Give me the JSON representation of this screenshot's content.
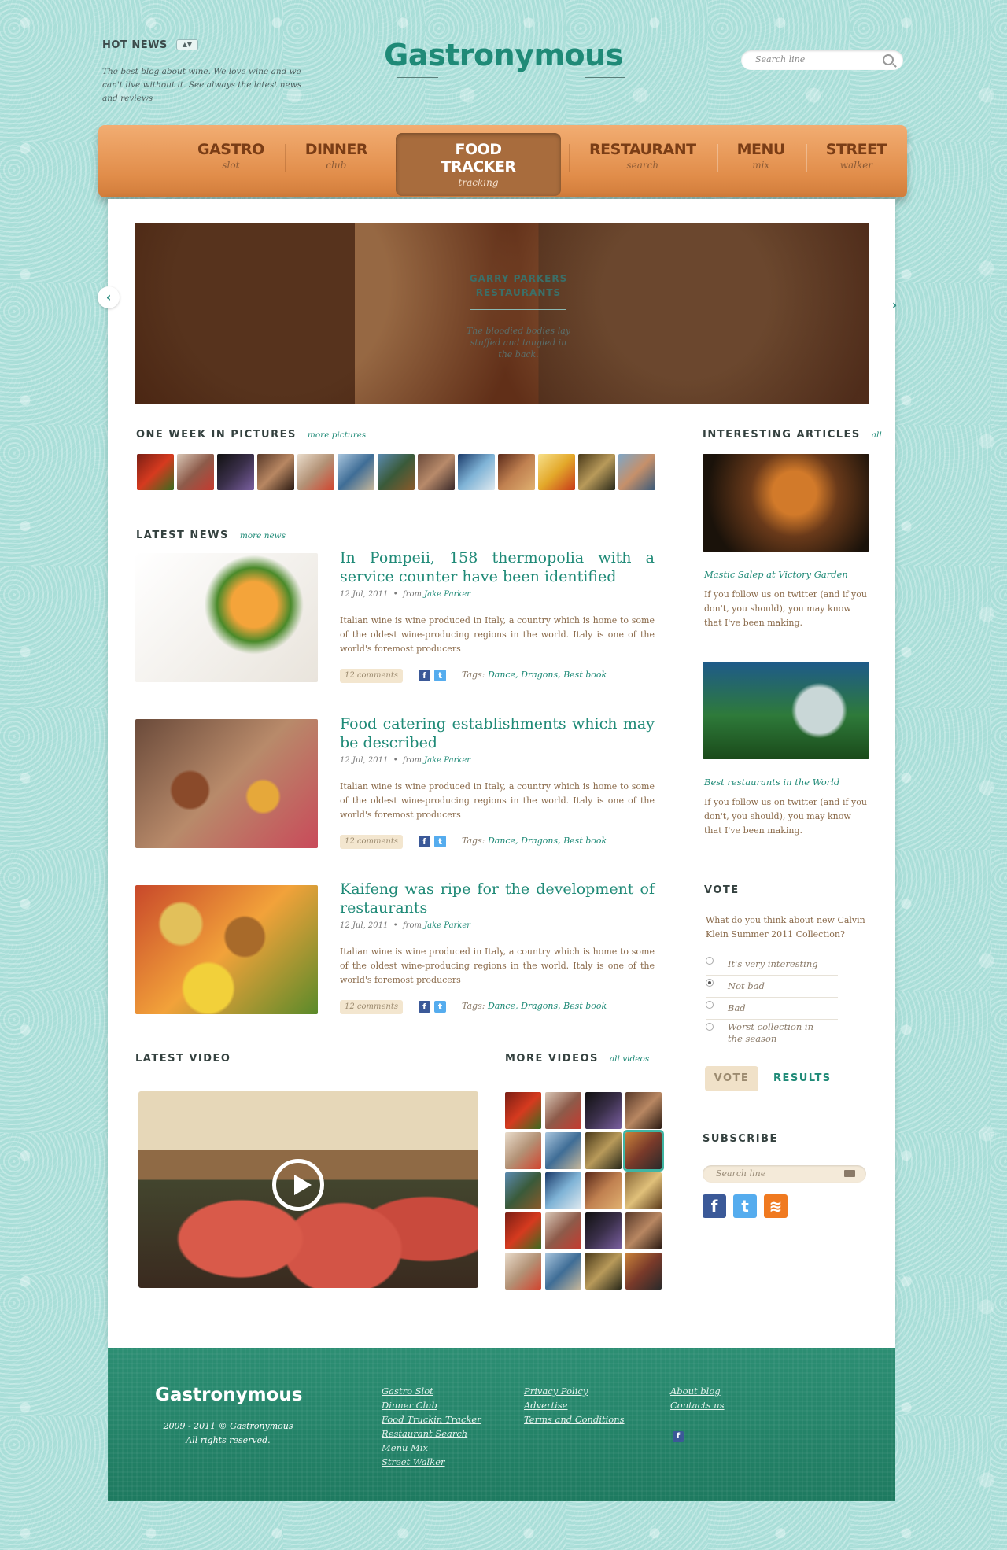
{
  "header": {
    "hot_news_title": "HOT NEWS",
    "hot_news_desc": "The best blog about wine. We love wine and we can't live without it. See always the latest news and reviews",
    "logo": "Gastronymous",
    "search_placeholder": "Search line"
  },
  "nav": [
    {
      "label": "GASTRO",
      "sub": "slot"
    },
    {
      "label": "DINNER",
      "sub": "club"
    },
    {
      "label": "FOOD TRACKER",
      "sub": "tracking",
      "active": true
    },
    {
      "label": "RESTAURANT",
      "sub": "search"
    },
    {
      "label": "MENU",
      "sub": "mix"
    },
    {
      "label": "STREET",
      "sub": "walker"
    }
  ],
  "slider": {
    "title_line1": "GARRY PARKERS",
    "title_line2": "RESTAURANTS",
    "desc": "The bloodied bodies lay stuffed and tangled in the back."
  },
  "pictures": {
    "title": "ONE WEEK IN PICTURES",
    "more": "more pictures"
  },
  "latest_news": {
    "title": "LATEST NEWS",
    "more": "more news",
    "items": [
      {
        "title": "In Pompeii, 158 thermopolia with a service counter have been identified",
        "date": "12 Jul, 2011",
        "from": "from",
        "author": "Jake Parker",
        "body": "Italian wine is wine produced in Italy, a country which is home to some of the oldest wine-producing regions in the world. Italy is one of the world's foremost producers",
        "comments": "12 comments",
        "tags_label": "Tags:",
        "tags": "Dance, Dragons, Best book"
      },
      {
        "title": "Food catering establishments which may be described",
        "date": "12 Jul, 2011",
        "from": "from",
        "author": "Jake Parker",
        "body": "Italian wine is wine produced in Italy, a country which is home to some of the oldest wine-producing regions in the world. Italy is one of the world's foremost producers",
        "comments": "12 comments",
        "tags_label": "Tags:",
        "tags": "Dance, Dragons, Best book"
      },
      {
        "title": "Kaifeng was ripe for the development of restaurants",
        "date": "12 Jul, 2011",
        "from": "from",
        "author": "Jake Parker",
        "body": "Italian wine is wine produced in Italy, a country which is home to some of the oldest wine-producing regions in the world. Italy is one of the world's foremost producers",
        "comments": "12 comments",
        "tags_label": "Tags:",
        "tags": "Dance, Dragons, Best book"
      }
    ]
  },
  "articles": {
    "title": "INTERESTING ARTICLES",
    "more": "all",
    "items": [
      {
        "title": "Mastic Salep at Victory Garden",
        "body": "If you follow us on twitter (and if you don't, you should), you may know that I've been making."
      },
      {
        "title": "Best restaurants in the World",
        "body": "If you follow us on twitter (and if you don't, you should), you may know that I've been making."
      }
    ]
  },
  "vote": {
    "title": "VOTE",
    "question": "What do you think about new Calvin Klein Summer 2011 Collection?",
    "options": [
      "It's very interesting",
      "Not bad",
      "Bad",
      "Worst collection in the season"
    ],
    "selected": 1,
    "vote_button": "VOTE",
    "results_button": "RESULTS"
  },
  "subscribe": {
    "title": "SUBSCRIBE",
    "placeholder": "Search line"
  },
  "video": {
    "latest_title": "LATEST VIDEO",
    "more_title": "MORE VIDEOS",
    "more_link": "all videos"
  },
  "footer": {
    "logo": "Gastronymous",
    "copyright_line1": "2009 - 2011 © Gastronymous",
    "copyright_line2": "All rights reserved.",
    "col1": [
      "Gastro Slot",
      "Dinner Club",
      "Food Truckin Tracker",
      "Restaurant Search",
      "Menu Mix",
      "Street Walker"
    ],
    "col2": [
      "Privacy Policy",
      "Advertise",
      "Terms and Conditions"
    ],
    "col3": [
      "About blog",
      "Contacts us"
    ]
  },
  "colors": {
    "accent": "#1f8a77",
    "nav_orange": "#e18d4a",
    "footer_green": "#1e7a60",
    "background": "#a9ddd6"
  }
}
